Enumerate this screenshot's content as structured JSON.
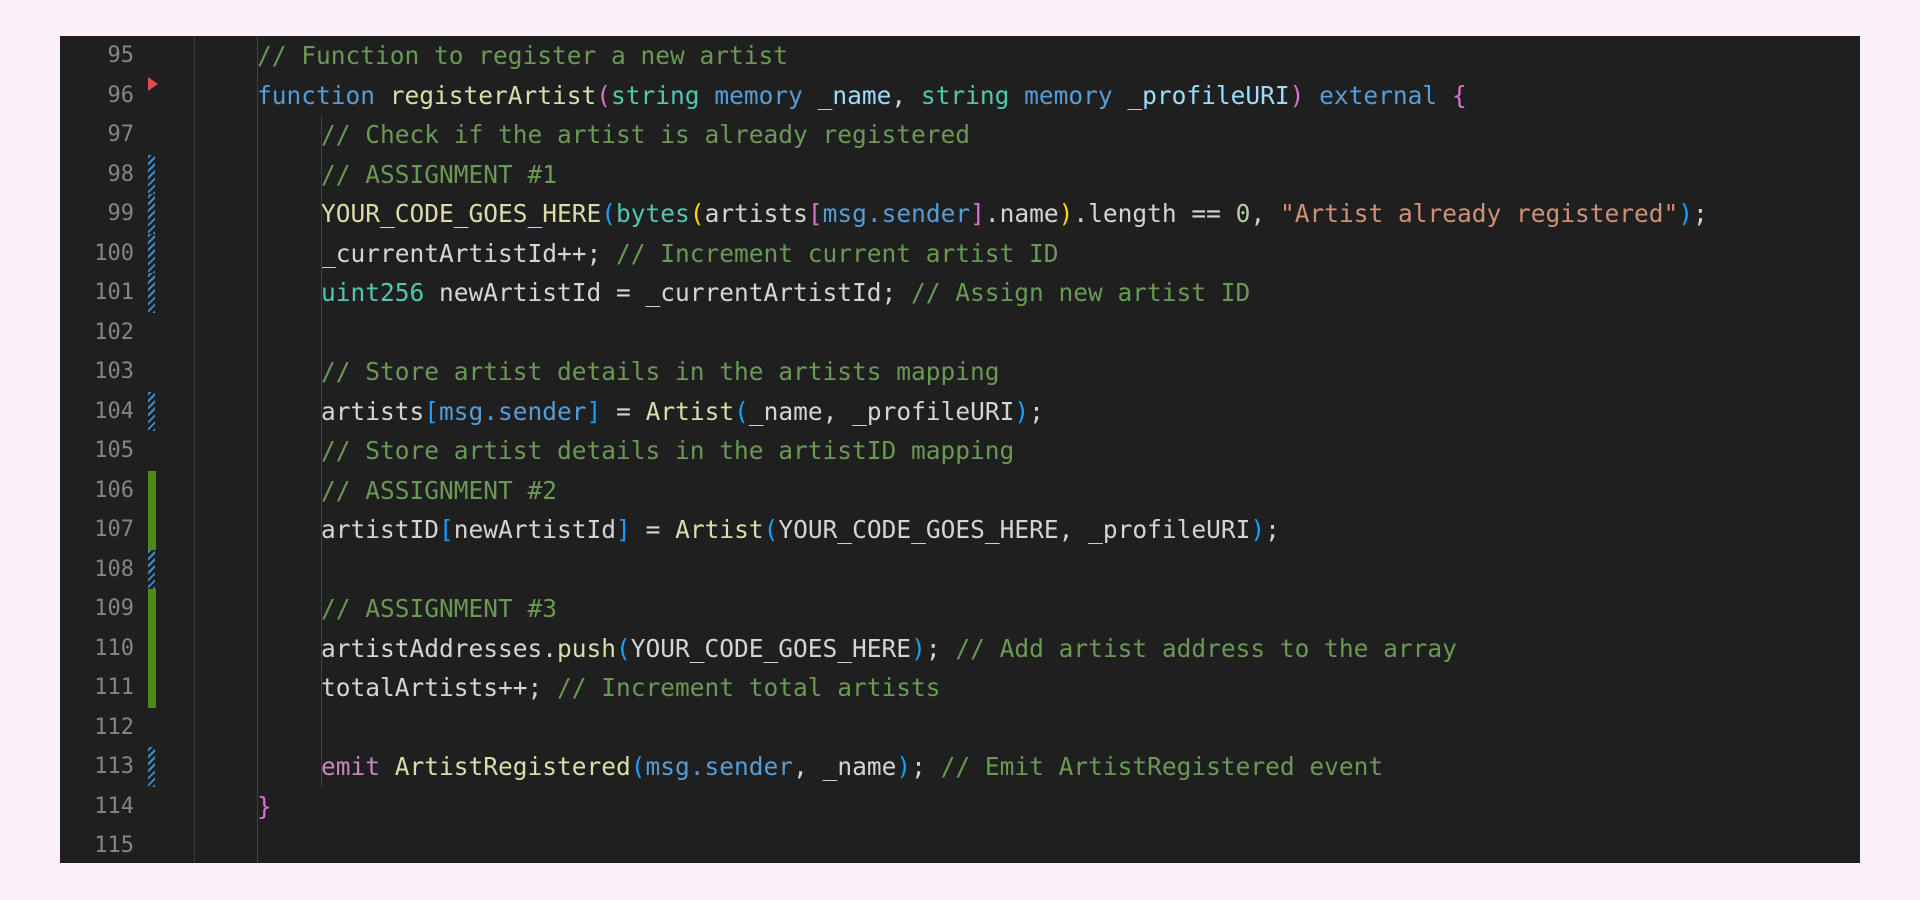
{
  "colors": {
    "background": "#fbf0f7",
    "editor_bg": "#1f1f1f",
    "line_number": "#858585",
    "modified_marker": "#4e8a1a",
    "striped_marker": "#3a8fd0",
    "breakpoint": "#e5484d"
  },
  "lines": [
    {
      "number": "95",
      "marker": "none",
      "breakpoint": false,
      "indent": 1,
      "tokens": [
        {
          "t": "// Function to register a new artist",
          "c": "cm"
        }
      ]
    },
    {
      "number": "96",
      "marker": "none",
      "breakpoint": true,
      "indent": 1,
      "tokens": [
        {
          "t": "function ",
          "c": "kw"
        },
        {
          "t": "registerArtist",
          "c": "fn"
        },
        {
          "t": "(",
          "c": "b2"
        },
        {
          "t": "string ",
          "c": "ty"
        },
        {
          "t": "memory ",
          "c": "kw"
        },
        {
          "t": "_name",
          "c": "pa"
        },
        {
          "t": ", ",
          "c": "pu"
        },
        {
          "t": "string ",
          "c": "ty"
        },
        {
          "t": "memory ",
          "c": "kw"
        },
        {
          "t": "_profileURI",
          "c": "pa"
        },
        {
          "t": ") ",
          "c": "b2"
        },
        {
          "t": "external ",
          "c": "kw"
        },
        {
          "t": "{",
          "c": "b2"
        }
      ]
    },
    {
      "number": "97",
      "marker": "none",
      "breakpoint": false,
      "indent": 2,
      "tokens": [
        {
          "t": "// Check if the artist is already registered",
          "c": "cm"
        }
      ]
    },
    {
      "number": "98",
      "marker": "striped",
      "breakpoint": false,
      "indent": 2,
      "tokens": [
        {
          "t": "// ASSIGNMENT #1",
          "c": "cm"
        }
      ]
    },
    {
      "number": "99",
      "marker": "striped",
      "breakpoint": false,
      "indent": 2,
      "tokens": [
        {
          "t": "YOUR_CODE_GOES_HERE",
          "c": "fn"
        },
        {
          "t": "(",
          "c": "b1"
        },
        {
          "t": "bytes",
          "c": "ty"
        },
        {
          "t": "(",
          "c": "b3"
        },
        {
          "t": "artists",
          "c": "pu"
        },
        {
          "t": "[",
          "c": "b2"
        },
        {
          "t": "msg.sender",
          "c": "kw"
        },
        {
          "t": "]",
          "c": "b2"
        },
        {
          "t": ".name",
          "c": "pu"
        },
        {
          "t": ")",
          "c": "b3"
        },
        {
          "t": ".length == ",
          "c": "pu"
        },
        {
          "t": "0",
          "c": "nu"
        },
        {
          "t": ", ",
          "c": "pu"
        },
        {
          "t": "\"Artist already registered\"",
          "c": "st"
        },
        {
          "t": ")",
          "c": "b1"
        },
        {
          "t": ";",
          "c": "pu"
        }
      ]
    },
    {
      "number": "100",
      "marker": "striped",
      "breakpoint": false,
      "indent": 2,
      "tokens": [
        {
          "t": "_currentArtistId++; ",
          "c": "pu"
        },
        {
          "t": "// Increment current artist ID",
          "c": "cm"
        }
      ]
    },
    {
      "number": "101",
      "marker": "striped",
      "breakpoint": false,
      "indent": 2,
      "tokens": [
        {
          "t": "uint256 ",
          "c": "ty"
        },
        {
          "t": "newArtistId = _currentArtistId; ",
          "c": "pu"
        },
        {
          "t": "// Assign new artist ID",
          "c": "cm"
        }
      ]
    },
    {
      "number": "102",
      "marker": "none",
      "breakpoint": false,
      "indent": 2,
      "tokens": []
    },
    {
      "number": "103",
      "marker": "none",
      "breakpoint": false,
      "indent": 2,
      "tokens": [
        {
          "t": "// Store artist details in the artists mapping",
          "c": "cm"
        }
      ]
    },
    {
      "number": "104",
      "marker": "striped",
      "breakpoint": false,
      "indent": 2,
      "tokens": [
        {
          "t": "artists",
          "c": "pu"
        },
        {
          "t": "[",
          "c": "b1"
        },
        {
          "t": "msg.sender",
          "c": "kw"
        },
        {
          "t": "]",
          "c": "b1"
        },
        {
          "t": " = ",
          "c": "pu"
        },
        {
          "t": "Artist",
          "c": "fn"
        },
        {
          "t": "(",
          "c": "b1"
        },
        {
          "t": "_name, _profileURI",
          "c": "pu"
        },
        {
          "t": ")",
          "c": "b1"
        },
        {
          "t": ";",
          "c": "pu"
        }
      ]
    },
    {
      "number": "105",
      "marker": "none",
      "breakpoint": false,
      "indent": 2,
      "tokens": [
        {
          "t": "// Store artist details in the artistID mapping",
          "c": "cm"
        }
      ]
    },
    {
      "number": "106",
      "marker": "modified",
      "breakpoint": false,
      "indent": 2,
      "tokens": [
        {
          "t": "// ASSIGNMENT #2",
          "c": "cm"
        }
      ]
    },
    {
      "number": "107",
      "marker": "modified",
      "breakpoint": false,
      "indent": 2,
      "tokens": [
        {
          "t": "artistID",
          "c": "pu"
        },
        {
          "t": "[",
          "c": "b1"
        },
        {
          "t": "newArtistId",
          "c": "pu"
        },
        {
          "t": "]",
          "c": "b1"
        },
        {
          "t": " = ",
          "c": "pu"
        },
        {
          "t": "Artist",
          "c": "fn"
        },
        {
          "t": "(",
          "c": "b1"
        },
        {
          "t": "YOUR_CODE_GOES_HERE, _profileURI",
          "c": "pu"
        },
        {
          "t": ")",
          "c": "b1"
        },
        {
          "t": ";",
          "c": "pu"
        }
      ]
    },
    {
      "number": "108",
      "marker": "striped",
      "breakpoint": false,
      "indent": 2,
      "tokens": []
    },
    {
      "number": "109",
      "marker": "modified",
      "breakpoint": false,
      "indent": 2,
      "tokens": [
        {
          "t": "// ASSIGNMENT #3",
          "c": "cm"
        }
      ]
    },
    {
      "number": "110",
      "marker": "modified",
      "breakpoint": false,
      "indent": 2,
      "tokens": [
        {
          "t": "artistAddresses.",
          "c": "pu"
        },
        {
          "t": "push",
          "c": "fn"
        },
        {
          "t": "(",
          "c": "b1"
        },
        {
          "t": "YOUR_CODE_GOES_HERE",
          "c": "pu"
        },
        {
          "t": ")",
          "c": "b1"
        },
        {
          "t": "; ",
          "c": "pu"
        },
        {
          "t": "// Add artist address to the array",
          "c": "cm"
        }
      ]
    },
    {
      "number": "111",
      "marker": "modified",
      "breakpoint": false,
      "indent": 2,
      "tokens": [
        {
          "t": "totalArtists++; ",
          "c": "pu"
        },
        {
          "t": "// Increment total artists",
          "c": "cm"
        }
      ]
    },
    {
      "number": "112",
      "marker": "none",
      "breakpoint": false,
      "indent": 2,
      "tokens": []
    },
    {
      "number": "113",
      "marker": "striped",
      "breakpoint": false,
      "indent": 2,
      "tokens": [
        {
          "t": "emit ",
          "c": "ct"
        },
        {
          "t": "ArtistRegistered",
          "c": "fn"
        },
        {
          "t": "(",
          "c": "b1"
        },
        {
          "t": "msg.sender",
          "c": "kw"
        },
        {
          "t": ", _name",
          "c": "pu"
        },
        {
          "t": ")",
          "c": "b1"
        },
        {
          "t": "; ",
          "c": "pu"
        },
        {
          "t": "// Emit ArtistRegistered event",
          "c": "cm"
        }
      ]
    },
    {
      "number": "114",
      "marker": "none",
      "breakpoint": false,
      "indent": 1,
      "tokens": [
        {
          "t": "}",
          "c": "b2"
        }
      ]
    },
    {
      "number": "115",
      "marker": "none",
      "breakpoint": false,
      "indent": 0,
      "tokens": []
    }
  ]
}
